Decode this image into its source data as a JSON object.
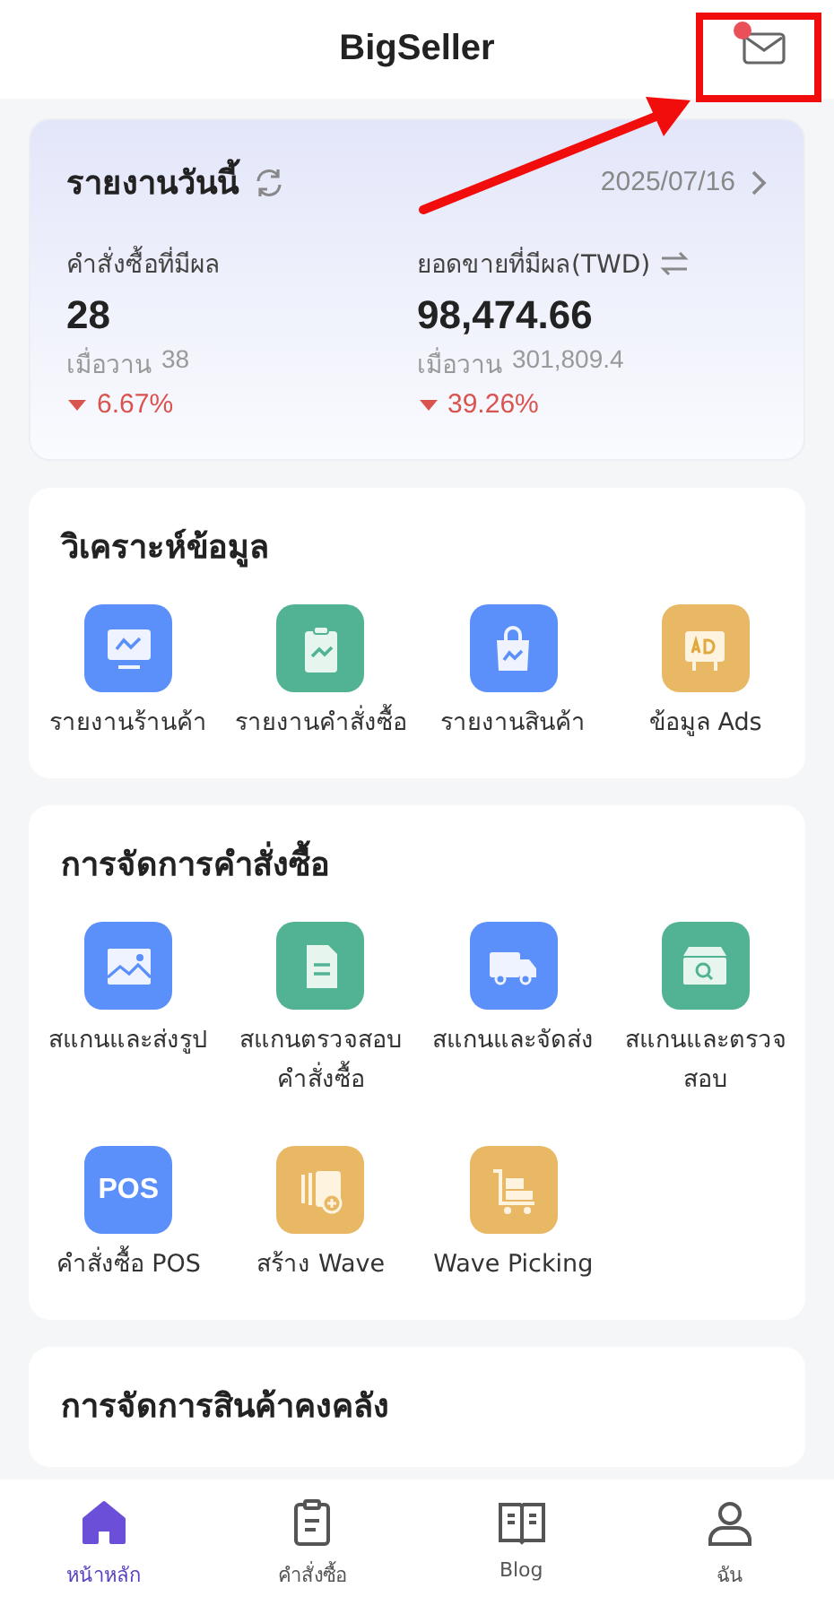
{
  "header": {
    "title": "BigSeller",
    "unread": true
  },
  "today_report": {
    "title": "รายงานวันนี้",
    "date": "2025/07/16",
    "metrics": [
      {
        "label": "คำสั่งซื้อที่มีผล",
        "switchable": false,
        "value": "28",
        "previous_label": "เมื่อวาน",
        "previous_value": "38",
        "decreased": true,
        "change": "6.67%"
      },
      {
        "label": "ยอดขายที่มีผล(TWD)",
        "switchable": true,
        "value": "98,474.66",
        "previous_label": "เมื่อวาน",
        "previous_value": "301,809.4",
        "decreased": true,
        "change": "39.26%"
      }
    ]
  },
  "sections": [
    {
      "title": "วิเคราะห์ข้อมูล",
      "tiles": [
        {
          "kind": "monitor",
          "color": "#5b8ff9",
          "label": "รายงานร้านค้า"
        },
        {
          "kind": "clipboard",
          "color": "#52b394",
          "label": "รายงานคำสั่งซื้อ"
        },
        {
          "kind": "bag",
          "color": "#5b8ff9",
          "label": "รายงานสินค้า"
        },
        {
          "kind": "ad",
          "color": "#e8b864",
          "label": "ข้อมูล Ads"
        }
      ]
    },
    {
      "title": "การจัดการคำสั่งซื้อ",
      "tiles": [
        {
          "kind": "image",
          "color": "#5b8ff9",
          "label": "สแกนและส่งรูป"
        },
        {
          "kind": "document",
          "color": "#52b394",
          "label": "สแกนตรวจสอบคำสั่งซื้อ"
        },
        {
          "kind": "truck",
          "color": "#5b8ff9",
          "label": "สแกนและจัดส่ง"
        },
        {
          "kind": "box",
          "color": "#52b394",
          "label": "สแกนและตรวจสอบ"
        },
        {
          "kind": "pos",
          "color": "#5b8ff9",
          "label": "คำสั่งซื้อ POS",
          "glyph": "POS"
        },
        {
          "kind": "stack",
          "color": "#e8b864",
          "label": "สร้าง Wave"
        },
        {
          "kind": "cart",
          "color": "#e8b864",
          "label": "Wave Picking"
        }
      ]
    },
    {
      "title": "การจัดการสินค้าคงคลัง"
    }
  ],
  "tab_bar": [
    {
      "kind": "home",
      "label": "หน้าหลัก",
      "selected": true
    },
    {
      "kind": "orders",
      "label": "คำสั่งซื้อ",
      "selected": false
    },
    {
      "kind": "blog",
      "label": "Blog",
      "selected": false
    },
    {
      "kind": "me",
      "label": "ฉัน",
      "selected": false
    }
  ]
}
